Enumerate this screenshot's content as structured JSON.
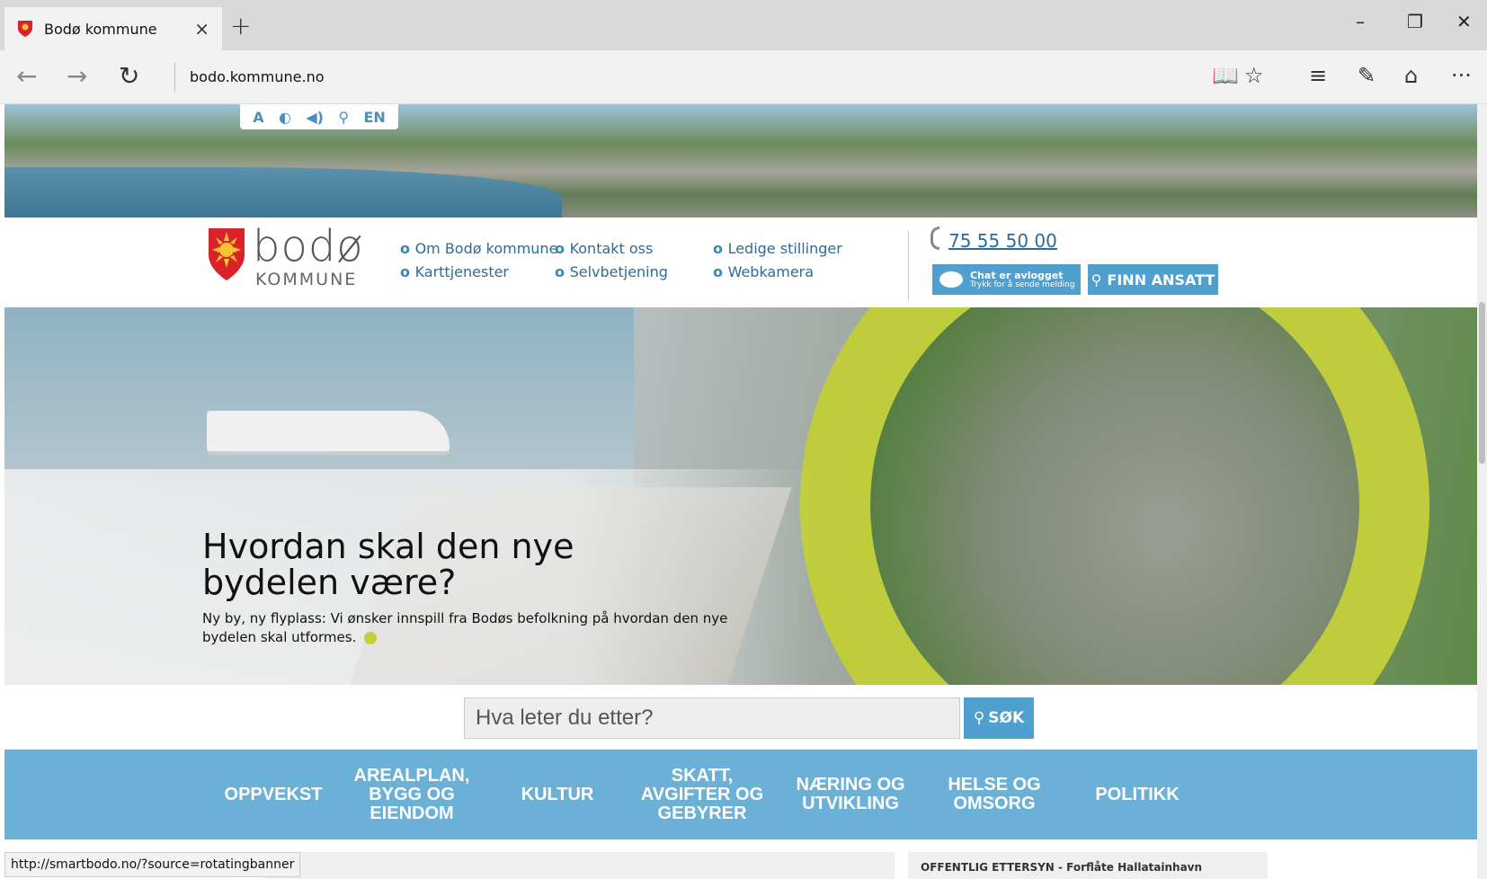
{
  "browser": {
    "tab_title": "Bodø kommune",
    "tab_close": "×",
    "new_tab": "+",
    "url": "bodo.kommune.no",
    "status_url": "http://smartbodo.no/?source=rotatingbanner",
    "win_min": "–",
    "win_restore": "❐",
    "win_close": "✕",
    "nav_back": "←",
    "nav_forward": "→",
    "nav_refresh": "↻",
    "tools": {
      "reading": "📖",
      "favorite": "☆",
      "hub": "≡",
      "note": "✎",
      "share": "⌂",
      "more": "···"
    }
  },
  "accessibility": {
    "text_size": "A",
    "contrast": "◐",
    "speech": "◀)",
    "sitemap": "⚲",
    "language": "EN"
  },
  "header": {
    "logo_name": "bodø",
    "logo_sub": "KOMMUNE",
    "links_col1": [
      "Om Bodø kommune",
      "Karttjenester"
    ],
    "links_col2": [
      "Kontakt oss",
      "Selvbetjening"
    ],
    "links_col3": [
      "Ledige stillinger",
      "Webkamera"
    ],
    "phone": "75 55 50 00",
    "chat_line1": "Chat er avlogget",
    "chat_line2": "Trykk for å sende melding",
    "find_label": "FINN ANSATT",
    "find_icon": "⚲"
  },
  "hero": {
    "title": "Hvordan skal den nye bydelen være?",
    "text": "Ny by, ny flyplass: Vi ønsker innspill fra Bodøs befolkning på hvordan den nye bydelen skal utformes."
  },
  "search": {
    "placeholder": "Hva leter du etter?",
    "button": "SØK",
    "icon": "⚲"
  },
  "categories": [
    "OPPVEKST",
    "AREALPLAN, BYGG OG EIENDOM",
    "KULTUR",
    "SKATT, AVGIFTER OG GEBYRER",
    "NÆRING OG UTVIKLING",
    "HELSE OG OMSORG",
    "POLITIKK"
  ],
  "below": {
    "notice": "OFFENTLIG ETTERSYN - Forflåte Hallatainhavn"
  },
  "colors": {
    "accent": "#4f9fcf",
    "category_bar": "#6bb0d6",
    "ring": "#bfcd3c",
    "link": "#2f6b99"
  }
}
